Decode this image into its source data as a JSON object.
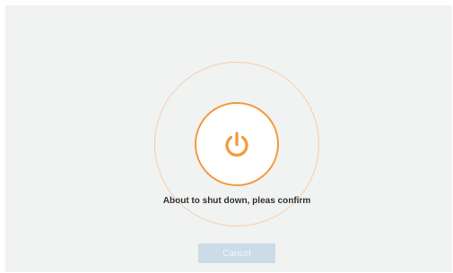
{
  "dialog": {
    "message": "About to shut down, pleas confirm",
    "cancel_label": "Cancel",
    "power_icon": "power-icon"
  },
  "colors": {
    "background": "#f1f2f2",
    "accent": "#f39a3c",
    "ring": "#f6cda9",
    "cancel_bg": "#cbdbe7",
    "cancel_text": "#f3f6f9",
    "message_text": "#333333"
  }
}
